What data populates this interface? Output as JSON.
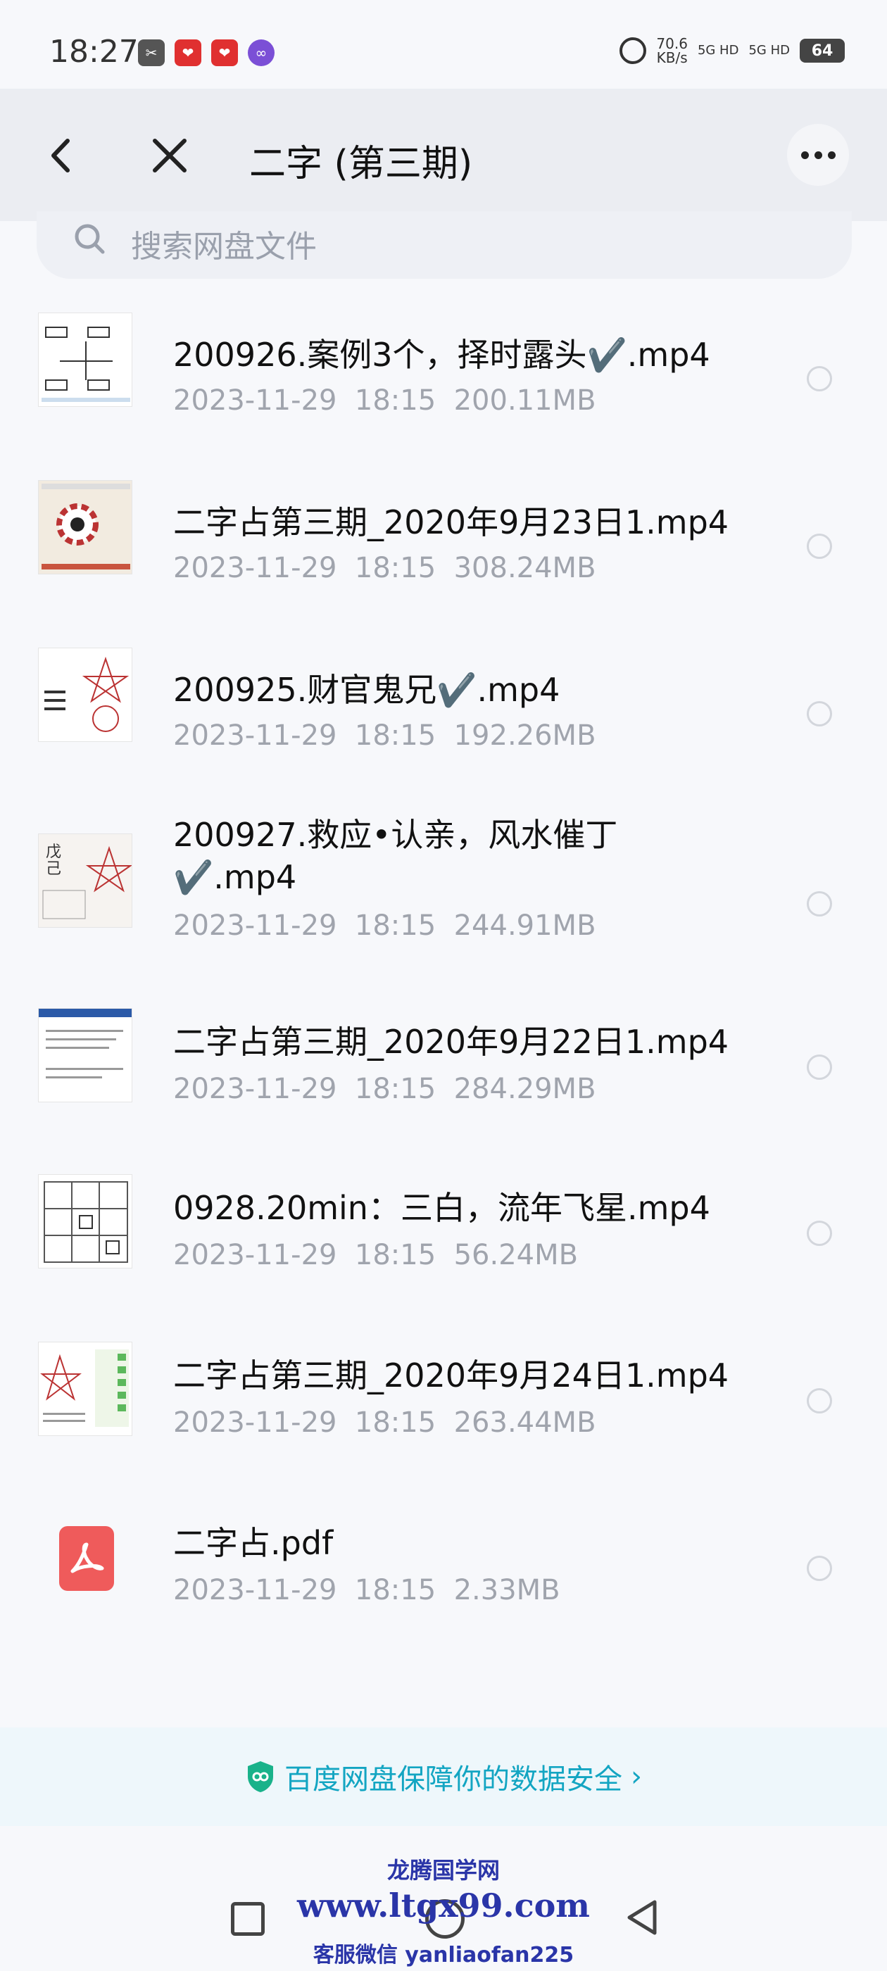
{
  "status_bar": {
    "time": "18:27",
    "speed": "70.6",
    "speed_unit": "KB/s",
    "net1": "5G HD",
    "net2": "5G HD",
    "battery": "64"
  },
  "header": {
    "title": "二字 (第三期)"
  },
  "search": {
    "placeholder": "搜索网盘文件"
  },
  "files": [
    {
      "name": "200926.案例3个，择时露头✔️.mp4",
      "meta": "2023-11-29  18:15  200.11MB"
    },
    {
      "name": "二字占第三期_2020年9月23日1.mp4",
      "meta": "2023-11-29  18:15  308.24MB"
    },
    {
      "name": "200925.财官鬼兄✔️.mp4",
      "meta": "2023-11-29  18:15  192.26MB"
    },
    {
      "name": "200927.救应•认亲，风水催丁✔️.mp4",
      "meta": "2023-11-29  18:15  244.91MB"
    },
    {
      "name": "二字占第三期_2020年9月22日1.mp4",
      "meta": "2023-11-29  18:15  284.29MB"
    },
    {
      "name": "0928.20min：三白，流年飞星.mp4",
      "meta": "2023-11-29  18:15  56.24MB"
    },
    {
      "name": "二字占第三期_2020年9月24日1.mp4",
      "meta": "2023-11-29  18:15  263.44MB"
    },
    {
      "name": "二字占.pdf",
      "meta": "2023-11-29  18:15  2.33MB"
    }
  ],
  "security_banner": {
    "text": "百度网盘保障你的数据安全",
    "chevron": "›"
  },
  "watermark": {
    "line1": "龙腾国学网",
    "line2": "www.ltgx99.com",
    "line3": "客服微信 yanliaofan225"
  },
  "colors": {
    "accent": "#13a5c2",
    "meta_text": "#a0a4ad",
    "header_bg": "#ebedf2"
  }
}
